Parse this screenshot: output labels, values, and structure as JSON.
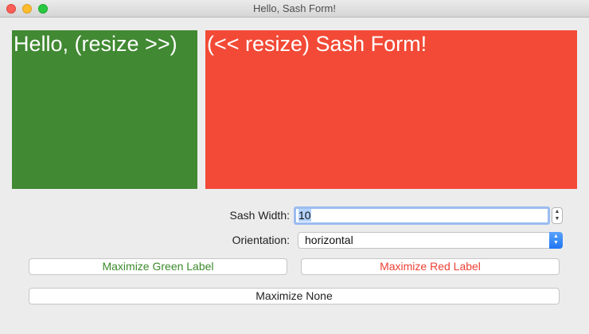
{
  "window": {
    "title": "Hello, Sash Form!"
  },
  "sash_form": {
    "green_label": "Hello, (resize >>)",
    "red_label": "(<< resize) Sash Form!"
  },
  "controls": {
    "sash_width_label": "Sash Width:",
    "sash_width_value": "10",
    "orientation_label": "Orientation:",
    "orientation_value": "horizontal"
  },
  "buttons": {
    "maximize_green": "Maximize Green Label",
    "maximize_red": "Maximize Red Label",
    "maximize_none": "Maximize None"
  },
  "colors": {
    "green_panel": "#418933",
    "red_panel": "#f24a36",
    "green_text": "#3b8a2c",
    "red_text": "#ee4135"
  },
  "icons": {
    "close": "close-icon",
    "minimize": "minimize-icon",
    "zoom": "zoom-icon",
    "stepper": "stepper-icon",
    "dropdown": "chevron-updown-icon"
  }
}
